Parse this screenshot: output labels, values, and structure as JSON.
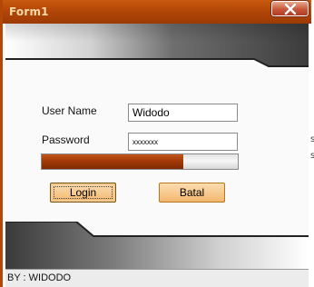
{
  "window": {
    "title": "Form1",
    "close_icon": "close-x-icon"
  },
  "form": {
    "username_label": "User Name",
    "username_value": "Widodo",
    "password_label": "Password",
    "password_value": "xxxxxxx",
    "progress_percent": 72,
    "login_label": "Login",
    "cancel_label": "Batal"
  },
  "statusbar": {
    "text": "BY : WIDODO"
  },
  "background_window": {
    "fragments": [
      "s",
      "s"
    ]
  },
  "colors": {
    "accent": "#b34708",
    "button": "#f7c98e",
    "progress": "#a43a08"
  }
}
